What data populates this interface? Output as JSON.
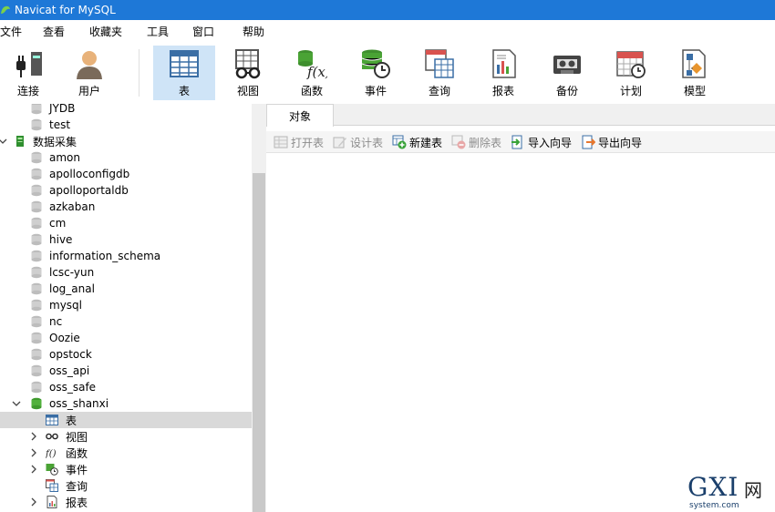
{
  "window": {
    "title": "Navicat for MySQL"
  },
  "menu": [
    "文件",
    "查看",
    "收藏夹",
    "工具",
    "窗口",
    "帮助"
  ],
  "toolbar": {
    "items": [
      {
        "label": "连接",
        "icon": "connection-plug-icon"
      },
      {
        "label": "用户",
        "icon": "user-icon"
      },
      {
        "label": "表",
        "icon": "table-icon",
        "active": true
      },
      {
        "label": "视图",
        "icon": "view-glasses-icon"
      },
      {
        "label": "函数",
        "icon": "function-fx-icon"
      },
      {
        "label": "事件",
        "icon": "event-clock-icon"
      },
      {
        "label": "查询",
        "icon": "query-icon"
      },
      {
        "label": "报表",
        "icon": "report-icon"
      },
      {
        "label": "备份",
        "icon": "backup-tape-icon"
      },
      {
        "label": "计划",
        "icon": "schedule-calendar-icon"
      },
      {
        "label": "模型",
        "icon": "model-diagram-icon"
      }
    ]
  },
  "tree": {
    "db_items_top": [
      "JYDB",
      "test"
    ],
    "connection": "数据采集",
    "db_items": [
      "amon",
      "apolloconfigdb",
      "apolloportaldb",
      "azkaban",
      "cm",
      "hive",
      "information_schema",
      "lcsc-yun",
      "log_anal",
      "mysql",
      "nc",
      "Oozie",
      "opstock",
      "oss_api",
      "oss_safe"
    ],
    "open_db": "oss_shanxi",
    "open_db_children": [
      "表",
      "视图",
      "函数",
      "事件",
      "查询",
      "报表"
    ]
  },
  "tabs": {
    "objects_label": "对象"
  },
  "object_toolbar": {
    "open_table": "打开表",
    "design_table": "设计表",
    "new_table": "新建表",
    "delete_table": "删除表",
    "import_wizard": "导入向导",
    "export_wizard": "导出向导"
  },
  "watermark": {
    "main": "GXI",
    "cn": "网",
    "site": "system.com"
  },
  "colors": {
    "titlebar": "#1e78d7",
    "active_tool": "#cfe4f7",
    "selected_row": "#d9d9d9"
  }
}
